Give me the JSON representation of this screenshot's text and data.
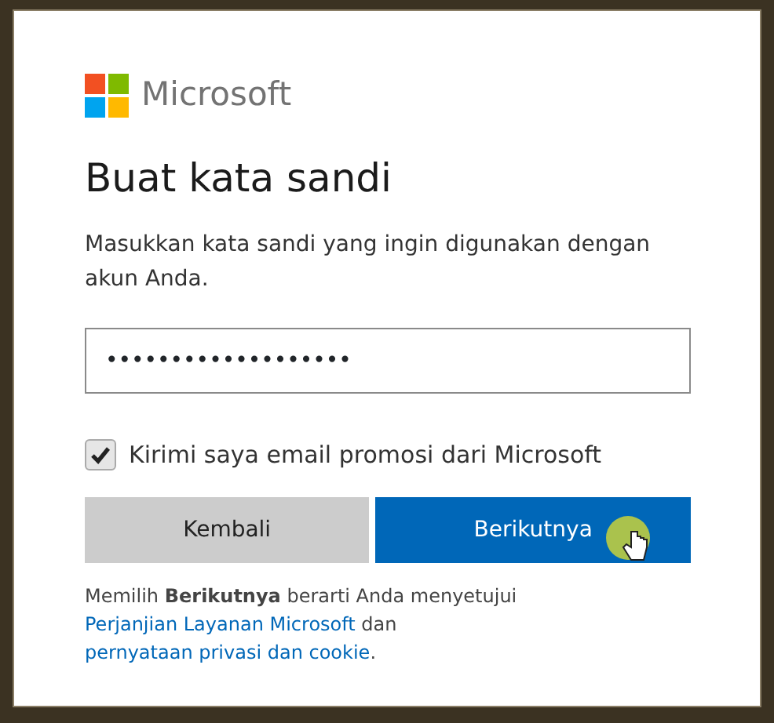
{
  "logo": {
    "text": "Microsoft"
  },
  "title": "Buat kata sandi",
  "description": "Masukkan kata sandi yang ingin digunakan dengan akun Anda.",
  "password_field": {
    "value": "•••••••••••••••••••"
  },
  "checkbox": {
    "label": "Kirimi saya email promosi dari Microsoft",
    "checked": true
  },
  "buttons": [
    {
      "label": "Kembali",
      "kind": "secondary"
    },
    {
      "label": "Berikutnya",
      "kind": "primary"
    }
  ],
  "footer": [
    {
      "kind": "text",
      "text": "Memilih **Berikutnya** berarti Anda menyetujui "
    },
    {
      "kind": "link",
      "text": "Perjanjian Layanan Microsoft"
    },
    {
      "kind": "text",
      "text": " dan "
    },
    {
      "kind": "link",
      "text": "pernyataan privasi dan cookie"
    },
    {
      "kind": "text",
      "text": "."
    }
  ]
}
